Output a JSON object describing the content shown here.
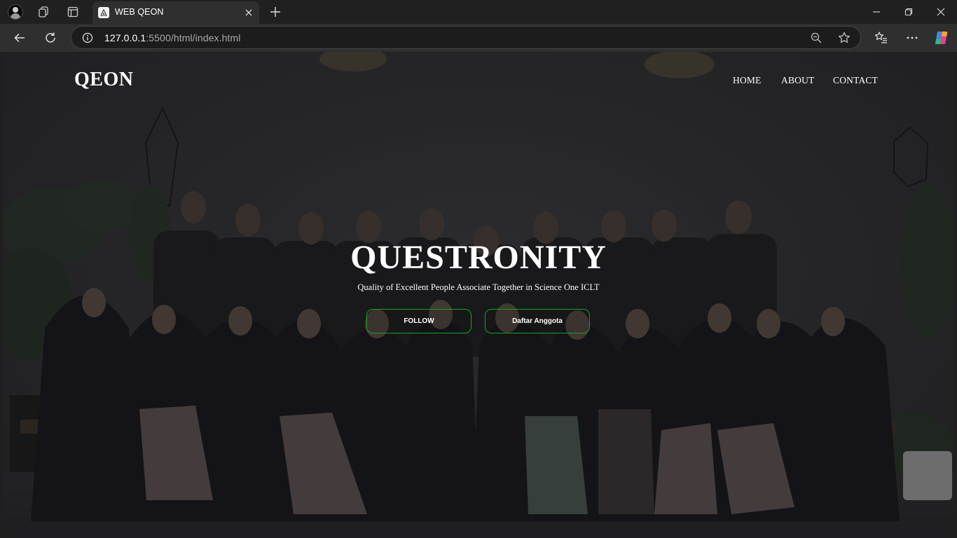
{
  "browser": {
    "tab": {
      "title": "WEB QEON"
    },
    "address": {
      "host": "127.0.0.1",
      "path": ":5500/html/index.html"
    }
  },
  "page": {
    "logo": "QEON",
    "nav": {
      "home": "HOME",
      "about": "ABOUT",
      "contact": "CONTACT"
    },
    "hero": {
      "title": "QUESTRONITY",
      "subtitle": "Quality of Excellent People Associate Together in Science One ICLT",
      "buttons": {
        "follow": "FOLLOW",
        "daftar": "Daftar Anggota"
      }
    },
    "background": "group-photo"
  },
  "colors": {
    "accent": "#19a11f",
    "chrome_dark": "#202020",
    "chrome_tab": "#2f2f2f"
  }
}
